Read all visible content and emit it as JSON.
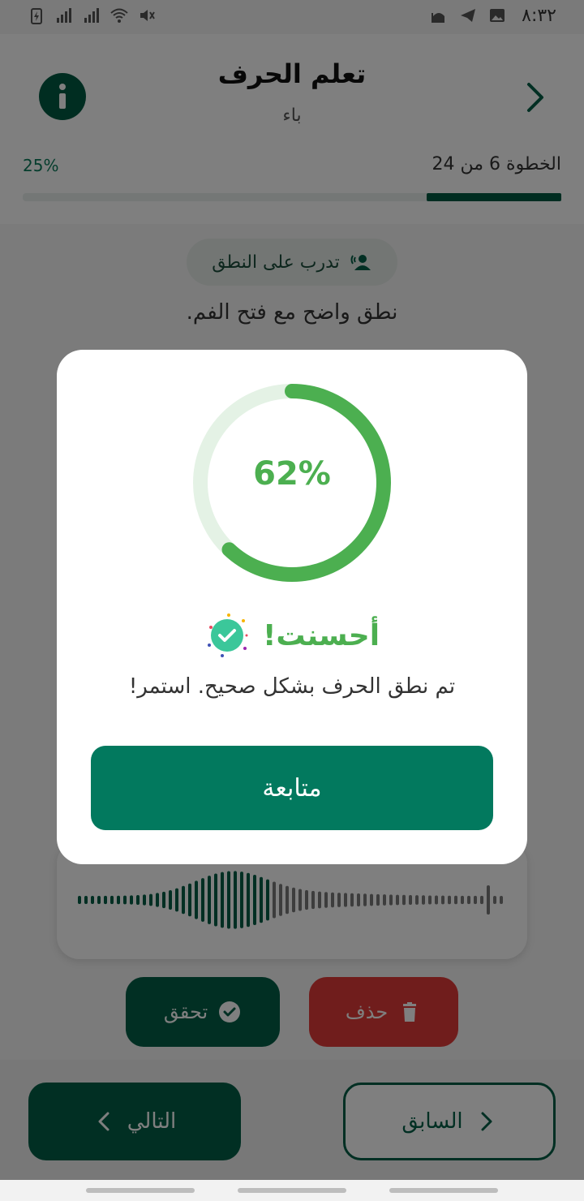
{
  "status_bar": {
    "time": "٨:٣٢",
    "icons": [
      "battery-charging-icon",
      "signal-icon",
      "signal-icon",
      "wifi-icon",
      "mute-icon",
      "mosque-icon",
      "telegram-icon",
      "gallery-icon"
    ]
  },
  "header": {
    "title": "تعلم الحرف",
    "subtitle": "باء",
    "step_text": "الخطوة 6 من 24",
    "progress_percent_label": "25%",
    "progress_fraction": 0.25
  },
  "practice": {
    "chip_label": "تدرب على النطق",
    "instruction": "نطق واضح مع فتح الفم."
  },
  "actions": {
    "check_label": "تحقق",
    "delete_label": "حذف"
  },
  "navigation": {
    "next_label": "التالي",
    "prev_label": "السابق"
  },
  "dialog": {
    "score_label": "62%",
    "score_fraction": 0.62,
    "title": "أحسنت!",
    "message": "تم نطق الحرف بشكل صحيح. استمر!",
    "continue_label": "متابعة"
  },
  "colors": {
    "primary": "#035f46",
    "success": "#4caf50",
    "danger": "#e13b38",
    "button_continue": "#02795e"
  }
}
